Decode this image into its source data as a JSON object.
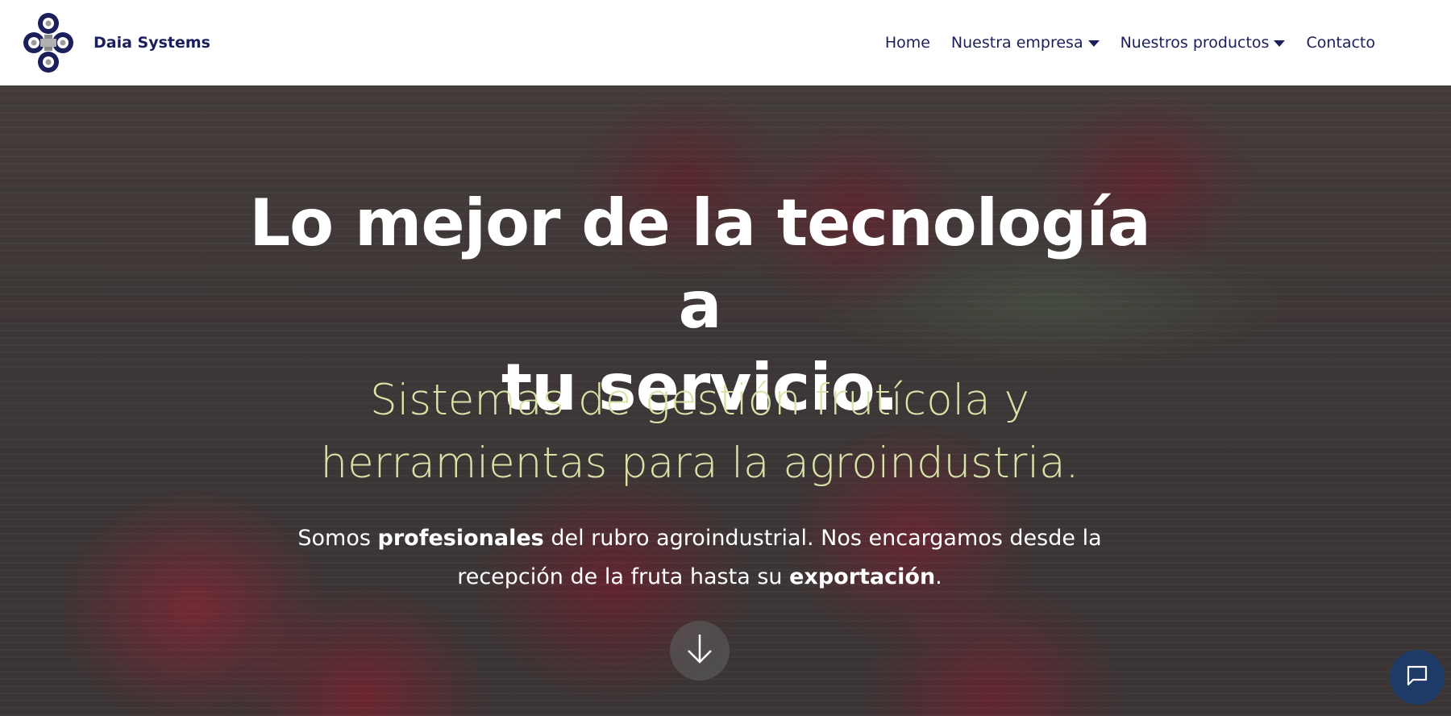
{
  "header": {
    "brand_name": "Daia Systems",
    "nav": {
      "home": "Home",
      "company": "Nuestra empresa",
      "products": "Nuestros productos",
      "contact": "Contacto"
    }
  },
  "hero": {
    "title_line1": "Lo mejor de la tecnología a",
    "title_line2": "tu servicio.",
    "subtitle_line1": "Sistemas de gestión frutícola y",
    "subtitle_line2": "herramientas para la agroindustria.",
    "desc_part1": "Somos ",
    "desc_bold1": "profesionales",
    "desc_part2": " del rubro agroindustrial. Nos encargamos desde la recepción de la fruta hasta su ",
    "desc_bold2": "exportación",
    "desc_part3": "."
  },
  "icons": {
    "logo": "flower-logo-icon",
    "dropdown": "caret-down-icon",
    "scroll": "arrow-down-icon",
    "chat": "chat-bubble-icon"
  },
  "colors": {
    "brand": "#1b1f5c",
    "subtitle": "#d9e3a8",
    "chat_button": "#1e3a66"
  }
}
